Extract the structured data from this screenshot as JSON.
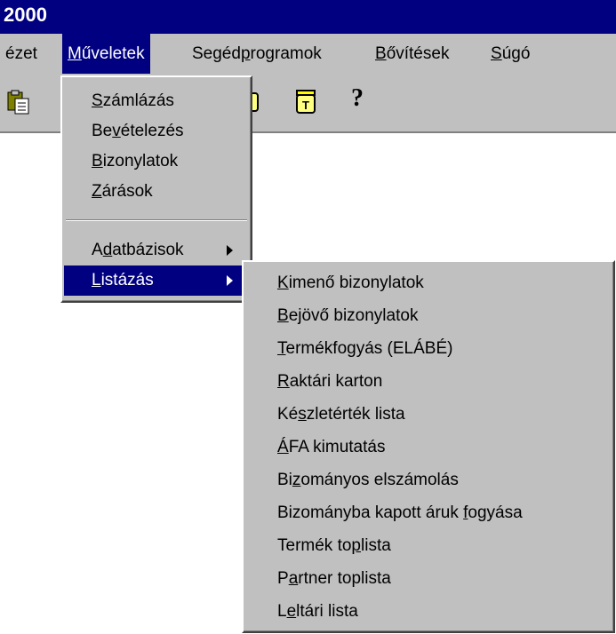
{
  "window": {
    "title": "2000"
  },
  "menubar": {
    "items": [
      {
        "pre": "ézet",
        "acc": "",
        "post": ""
      },
      {
        "pre": "",
        "acc": "M",
        "post": "űveletek"
      },
      {
        "pre": "Segéd",
        "acc": "p",
        "post": "rogramok"
      },
      {
        "pre": "",
        "acc": "B",
        "post": "ővítések"
      },
      {
        "pre": "",
        "acc": "S",
        "post": "úgó"
      }
    ]
  },
  "toolbar": {
    "help_glyph": "?"
  },
  "muveletek_menu": {
    "items": [
      {
        "pre": "",
        "acc": "S",
        "post": "zámlázás"
      },
      {
        "pre": "Be",
        "acc": "v",
        "post": "ételezés"
      },
      {
        "pre": "",
        "acc": "B",
        "post": "izonylatok"
      },
      {
        "pre": "",
        "acc": "Z",
        "post": "árások"
      },
      {
        "pre": "A",
        "acc": "d",
        "post": "atbázisok"
      },
      {
        "pre": "",
        "acc": "L",
        "post": "istázás"
      }
    ]
  },
  "listazas_menu": {
    "items": [
      {
        "pre": "",
        "acc": "K",
        "post": "imenő bizonylatok"
      },
      {
        "pre": "",
        "acc": "B",
        "post": "ejövő bizonylatok"
      },
      {
        "pre": "",
        "acc": "T",
        "post": "ermékfogyás (ELÁBÉ)"
      },
      {
        "pre": "",
        "acc": "R",
        "post": "aktári karton"
      },
      {
        "pre": "Ké",
        "acc": "s",
        "post": "zletérték lista"
      },
      {
        "pre": "",
        "acc": "Á",
        "post": "FA kimutatás"
      },
      {
        "pre": "Bi",
        "acc": "z",
        "post": "ományos elszámolás"
      },
      {
        "pre": "Bizományba kapott áruk ",
        "acc": "f",
        "post": "ogyása"
      },
      {
        "pre": "Termék to",
        "acc": "p",
        "post": "lista"
      },
      {
        "pre": "P",
        "acc": "a",
        "post": "rtner toplista"
      },
      {
        "pre": "L",
        "acc": "e",
        "post": "ltári lista"
      }
    ]
  }
}
